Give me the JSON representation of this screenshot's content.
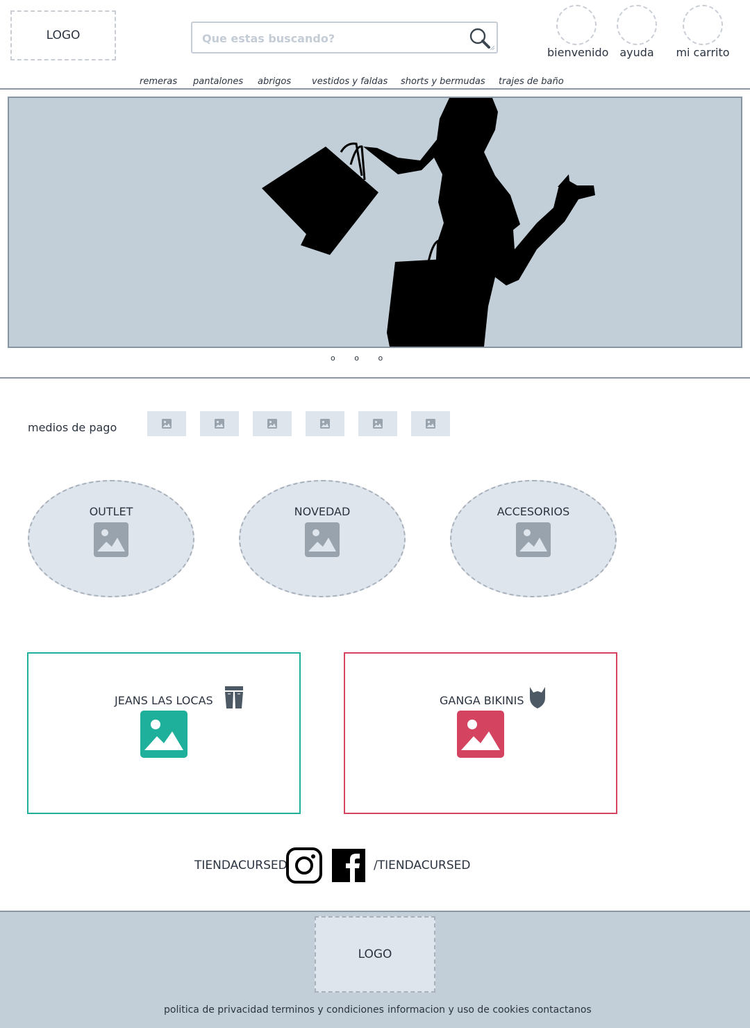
{
  "header": {
    "logo": "LOGO",
    "search_placeholder": "Que estas buscando?",
    "items": [
      {
        "label": "bienvenido",
        "icon": "user-avatar-placeholder"
      },
      {
        "label": "ayuda",
        "icon": "help-placeholder"
      },
      {
        "label": "mi carrito",
        "icon": "cart-placeholder"
      }
    ]
  },
  "nav": [
    "remeras",
    "pantalones",
    "abrigos",
    "vestidos y faldas",
    "shorts y bermudas",
    "trajes de baño"
  ],
  "hero": {
    "image": "shopping-woman-silhouette",
    "carousel_dots": "o o o"
  },
  "payment": {
    "label": "medios de pago",
    "tiles": 6,
    "icon": "image-placeholder-icon"
  },
  "categories": [
    {
      "label": "OUTLET",
      "icon": "image-placeholder-icon"
    },
    {
      "label": "NOVEDAD",
      "icon": "image-placeholder-icon"
    },
    {
      "label": "ACCESORIOS",
      "icon": "image-placeholder-icon"
    }
  ],
  "promos": [
    {
      "label": "JEANS LAS LOCAS",
      "icon": "jeans-icon",
      "color": "#1eb09b"
    },
    {
      "label": "GANGA BIKINIS",
      "icon": "bikini-icon",
      "color": "#d44460"
    }
  ],
  "social": {
    "left": "TIENDACURSED",
    "right": "/TIENDACURSED",
    "icons": [
      "instagram-icon",
      "facebook-icon"
    ]
  },
  "footer": {
    "logo": "LOGO",
    "links": [
      "politica de privacidad",
      "terminos y condiciones",
      "informacion y uso de cookies",
      "contactanos"
    ]
  },
  "colors": {
    "panel": "#c2ced8",
    "placeholder": "#dfe5ec",
    "jeans": "#1eb09b",
    "bikini": "#d44460"
  }
}
